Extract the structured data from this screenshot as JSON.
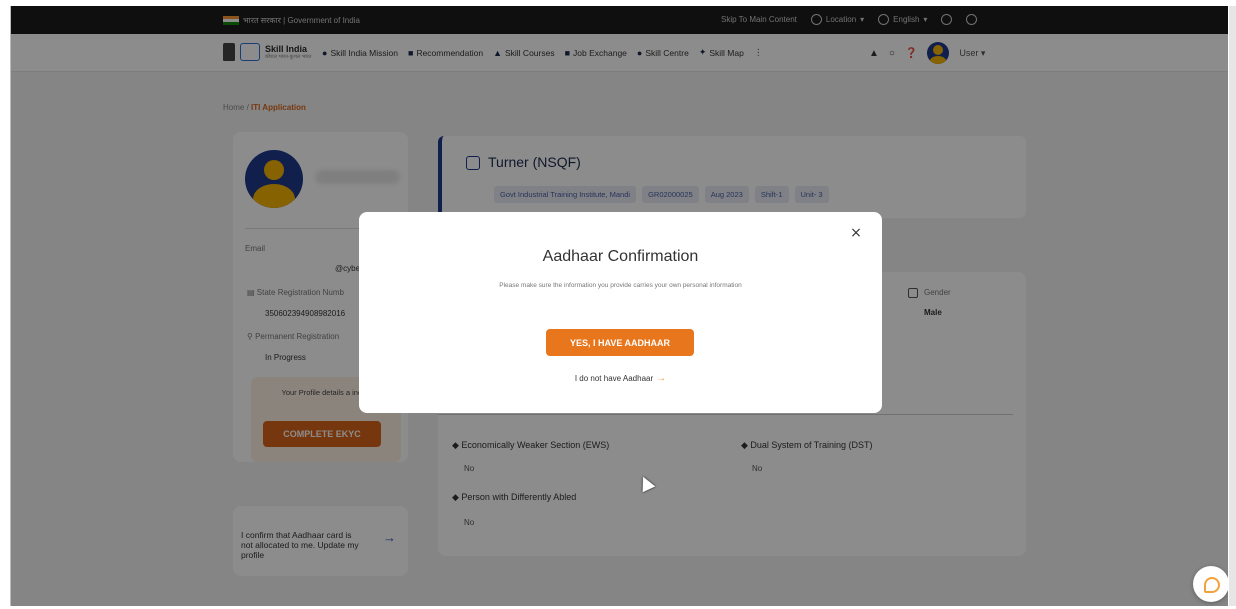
{
  "topbar": {
    "gov_text": "भारत सरकार | Government of India",
    "skip_link": "Skip To Main Content",
    "location": "Location",
    "language": "English"
  },
  "brand": {
    "name": "Skill India",
    "sub": "कौशल भारत-कुशल भारत"
  },
  "nav": {
    "items": [
      {
        "label": "Skill India Mission"
      },
      {
        "label": "Recommendation"
      },
      {
        "label": "Skill Courses"
      },
      {
        "label": "Job Exchange"
      },
      {
        "label": "Skill Centre"
      },
      {
        "label": "Skill Map"
      }
    ],
    "user_label": "User"
  },
  "breadcrumb": {
    "home": "Home",
    "separator": "/",
    "current": "ITI Application"
  },
  "profile": {
    "email_label": "Email",
    "email_value": "@cybers",
    "state_reg_label": "State Registration Numb",
    "state_reg_value": "350602394908982016",
    "perm_reg_label": "Permanent Registration",
    "perm_reg_value": "In Progress",
    "ekyc_message": "Your Profile details a incomplete!",
    "ekyc_button": "COMPLETE EKYC"
  },
  "confirm_card": {
    "text": "I confirm that Aadhaar card is not allocated to me. Update my profile"
  },
  "course": {
    "title": "Turner (NSQF)",
    "chips": [
      {
        "text": "Govt Industrial Training Institute, Mandi"
      },
      {
        "text": "GR02000025"
      },
      {
        "text": "Aug 2023"
      },
      {
        "text": "Shift-1"
      },
      {
        "text": "Unit- 3"
      }
    ]
  },
  "details": {
    "gender_label": "Gender",
    "gender_value": "Male",
    "ews_label": "Economically Weaker Section (EWS)",
    "ews_value": "No",
    "dst_label": "Dual System of Training (DST)",
    "dst_value": "No",
    "pwd_label": "Person with Differently Abled",
    "pwd_value": "No"
  },
  "modal": {
    "title": "Aadhaar Confirmation",
    "description": "Please make sure the information you provide carries your own personal information",
    "yes_button": "YES, I HAVE AADHAAR",
    "no_link": "I do not have Aadhaar",
    "close_glyph": "×"
  },
  "colors": {
    "accent_orange": "#e8761c",
    "brand_navy": "#1e3a8a"
  }
}
